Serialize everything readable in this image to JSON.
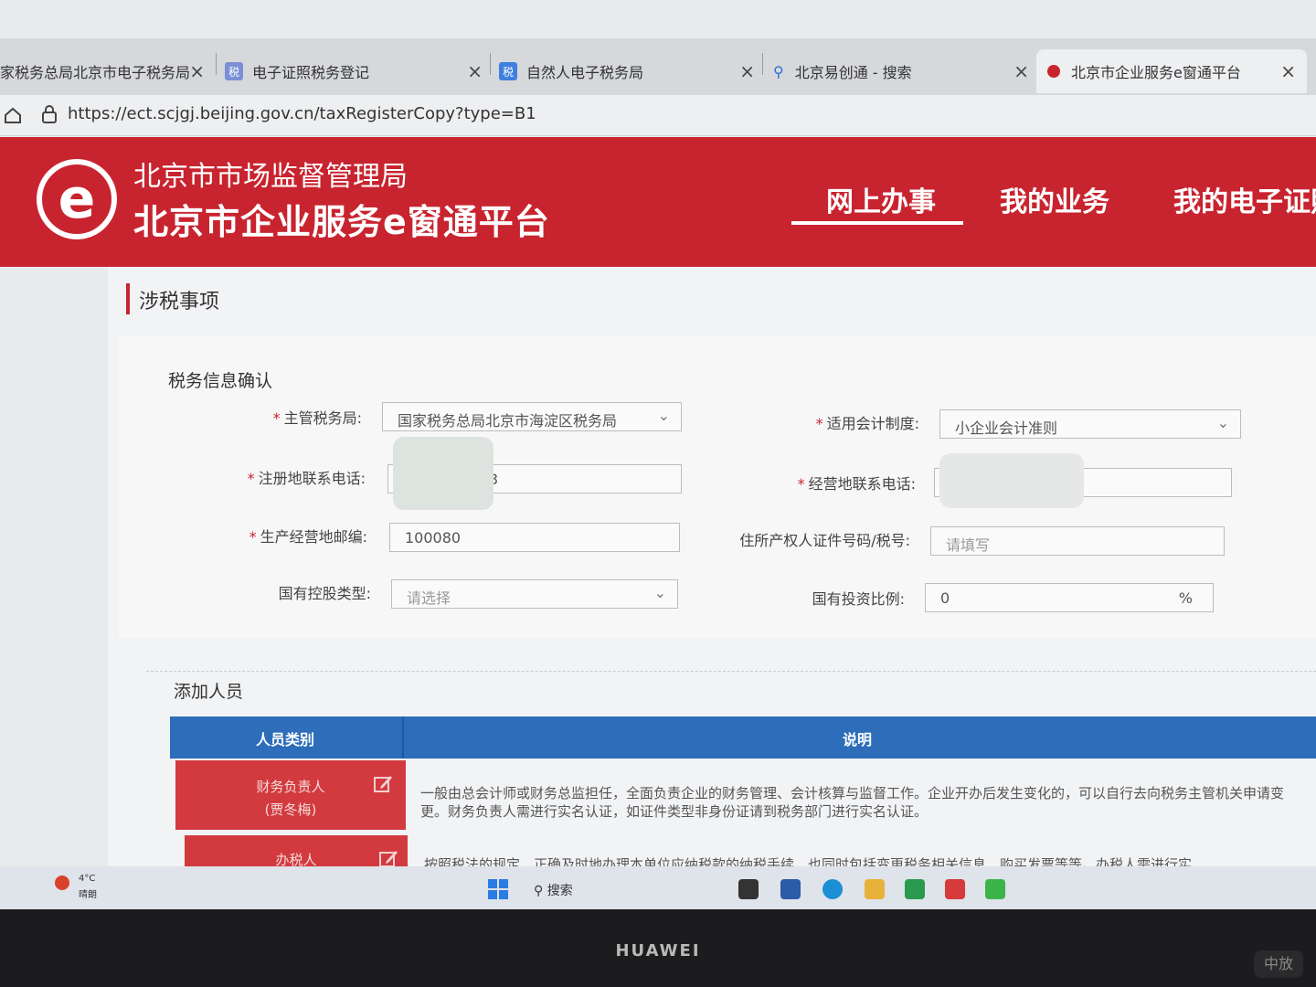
{
  "browser": {
    "tabs": [
      {
        "label": "家税务总局北京市电子税务局",
        "close": "×"
      },
      {
        "label": "电子证照税务登记",
        "close": "×",
        "icon_text": "税"
      },
      {
        "label": "自然人电子税务局",
        "close": "×",
        "icon_text": "税"
      },
      {
        "label": "北京易创通 - 搜索",
        "close": "×"
      },
      {
        "label": "北京市企业服务e窗通平台",
        "close": "×"
      }
    ],
    "url": "https://ect.scjgj.beijing.gov.cn/taxRegisterCopy?type=B1"
  },
  "header": {
    "logo_letter": "e",
    "org_name": "北京市市场监督管理局",
    "platform_name": "北京市企业服务e窗通平台",
    "nav": [
      "网上办事",
      "我的业务",
      "我的电子证照"
    ]
  },
  "section": {
    "title": "涉税事项"
  },
  "tax_form": {
    "title": "税务信息确认",
    "fields": {
      "tax_bureau": {
        "label": "主管税务局:",
        "value": "国家税务总局北京市海淀区税务局"
      },
      "accounting_system": {
        "label": "适用会计制度:",
        "value": "小企业会计准则"
      },
      "reg_phone": {
        "label": "注册地联系电话:",
        "value": "3"
      },
      "biz_phone": {
        "label": "经营地联系电话:",
        "value": ""
      },
      "postcode": {
        "label": "生产经营地邮编:",
        "value": "100080"
      },
      "owner_id": {
        "label": "住所产权人证件号码/税号:",
        "placeholder": "请填写"
      },
      "state_holding_type": {
        "label": "国有控股类型:",
        "placeholder": "请选择"
      },
      "state_invest_ratio": {
        "label": "国有投资比例:",
        "value": "0",
        "unit": "%"
      }
    },
    "required_mark": "*"
  },
  "personnel": {
    "title": "添加人员",
    "columns": [
      "人员类别",
      "说明"
    ],
    "rows": [
      {
        "role": "财务负责人",
        "name": "(贾冬梅)",
        "description": "一般由总会计师或财务总监担任，全面负责企业的财务管理、会计核算与监督工作。企业开办后发生变化的，可以自行去向税务主管机关申请变更。财务负责人需进行实名认证，如证件类型非身份证请到税务部门进行实名认证。"
      },
      {
        "role": "办税人",
        "name": "",
        "description": "按照税法的规定，正确及时地办理本单位应纳税款的纳税手续，也同时包括变更税务相关信息，购买发票等等。办税人需进行实"
      }
    ]
  },
  "taskbar": {
    "weather_temp": "4°C",
    "weather_text": "晴朗",
    "search_label": "搜索",
    "ime": "中",
    "brand": "HUAWEI"
  },
  "colors": {
    "brand_red": "#c8242f",
    "table_blue": "#2d6db9"
  }
}
